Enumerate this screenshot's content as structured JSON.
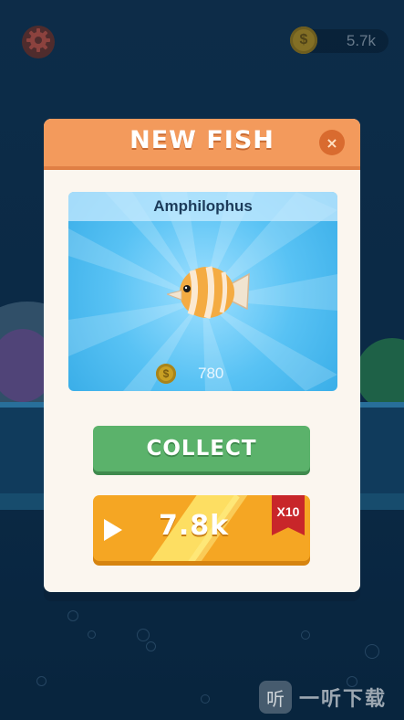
{
  "hud": {
    "settings_icon": "gear-icon",
    "coins_icon": "coin-icon",
    "coins_value": "5.7k"
  },
  "dialog": {
    "title": "NEW FISH",
    "close_symbol": "×",
    "fish": {
      "name": "Amphilophus",
      "price": "780",
      "price_icon": "coin-icon"
    },
    "collect_label": "COLLECT",
    "video_reward": {
      "value": "7.8k",
      "multiplier": "X10",
      "icon": "play-icon"
    }
  },
  "watermark": {
    "logo_text": "听",
    "text": "一听下载"
  },
  "colors": {
    "header": "#f39a5c",
    "collect": "#5bb26b",
    "video": "#f5a623",
    "ribbon": "#c8262a"
  }
}
